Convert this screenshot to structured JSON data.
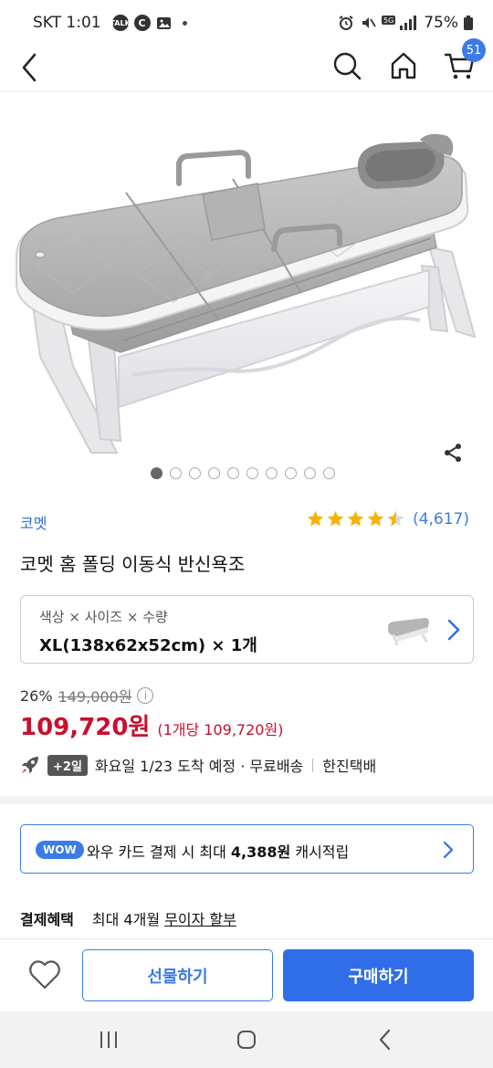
{
  "status_bar": {
    "carrier_time": "SKT 1:01",
    "talk_icon_text": "TALK",
    "c_icon_text": "C",
    "battery": "75%"
  },
  "nav": {
    "cart_count": "51"
  },
  "gallery": {
    "total_images": 10,
    "current_index": 0
  },
  "product": {
    "brand": "코멧",
    "rating": 4.5,
    "review_count": "(4,617)",
    "title": "코멧 홈 폴딩 이동식 반신욕조"
  },
  "option": {
    "label": "색상 × 사이즈 × 수량",
    "value": "XL(138x62x52cm) × 1개"
  },
  "price": {
    "discount_rate": "26%",
    "original_price": "149,000원",
    "info_icon_text": "i",
    "sale_price": "109,720원",
    "unit_price": "(1개당 109,720원)"
  },
  "delivery": {
    "badge": "+2일",
    "date_text": "화요일 1/23 도착 예정 · 무료배송",
    "carrier": "한진택배"
  },
  "wow": {
    "badge": "WOW",
    "text_prefix": "와우 카드 결제 시 최대 ",
    "amount": "4,388원",
    "text_suffix": " 캐시적립"
  },
  "benefit": {
    "label": "결제혜택",
    "text_prefix": "최대 4개월 ",
    "link": "무이자 할부"
  },
  "actions": {
    "gift_label": "선물하기",
    "buy_label": "구매하기"
  },
  "colors": {
    "accent_blue": "#3a7be8",
    "price_red": "#c8102e",
    "star_yellow": "#f5b400"
  }
}
